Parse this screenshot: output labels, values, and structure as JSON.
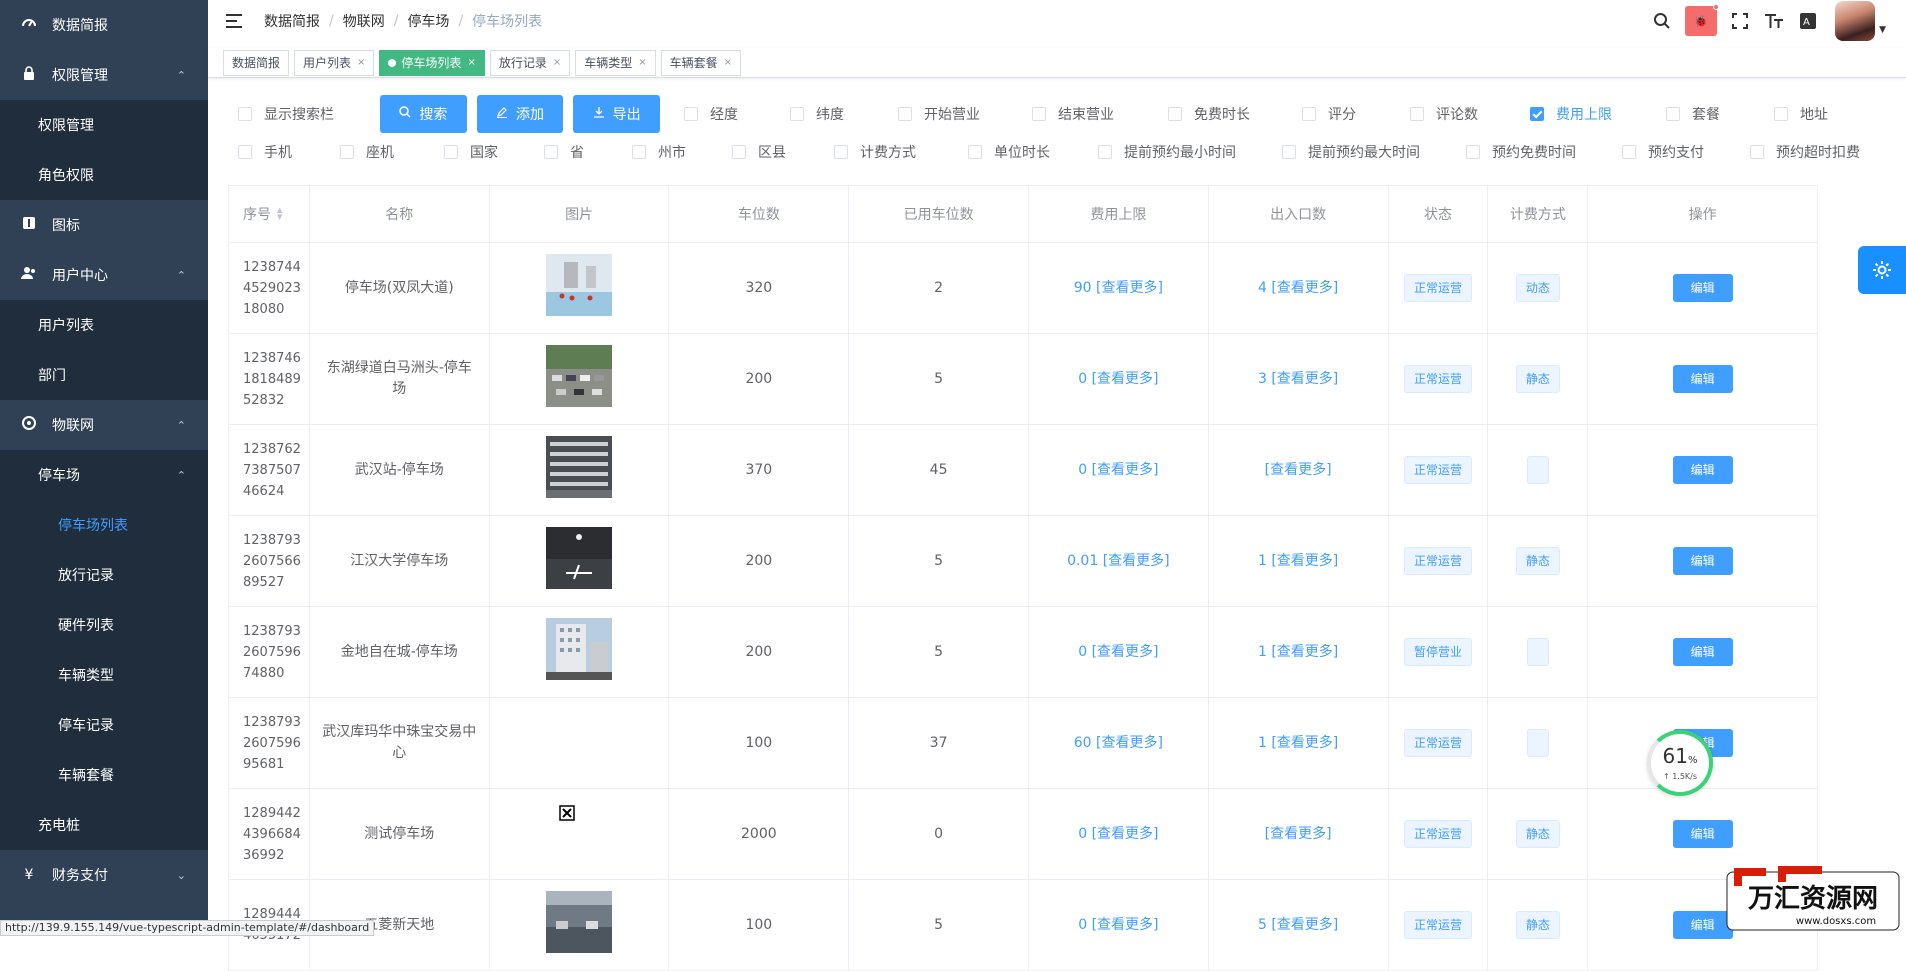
{
  "sidebar": {
    "items": [
      {
        "label": "数据简报",
        "icon": "dashboard-icon",
        "kind": "top"
      },
      {
        "label": "权限管理",
        "icon": "lock-icon",
        "kind": "top",
        "chev": "⌃"
      },
      {
        "label": "权限管理",
        "kind": "sub"
      },
      {
        "label": "角色权限",
        "kind": "sub"
      },
      {
        "label": "图标",
        "icon": "info-icon",
        "kind": "top"
      },
      {
        "label": "用户中心",
        "icon": "users-icon",
        "kind": "top",
        "chev": "⌃"
      },
      {
        "label": "用户列表",
        "kind": "sub"
      },
      {
        "label": "部门",
        "kind": "sub"
      },
      {
        "label": "物联网",
        "icon": "iot-icon",
        "kind": "top",
        "chev": "⌃"
      },
      {
        "label": "停车场",
        "kind": "sub",
        "chev": "⌃"
      },
      {
        "label": "停车场列表",
        "kind": "sub2",
        "active": true
      },
      {
        "label": "放行记录",
        "kind": "sub2"
      },
      {
        "label": "硬件列表",
        "kind": "sub2"
      },
      {
        "label": "车辆类型",
        "kind": "sub2"
      },
      {
        "label": "停车记录",
        "kind": "sub2"
      },
      {
        "label": "车辆套餐",
        "kind": "sub2"
      },
      {
        "label": "充电桩",
        "kind": "sub"
      },
      {
        "label": "财务支付",
        "icon": "yen-icon",
        "kind": "top",
        "chev": "⌄"
      }
    ]
  },
  "breadcrumb": [
    "数据简报",
    "物联网",
    "停车场",
    "停车场列表"
  ],
  "navbar": {
    "bug_label": "🐞"
  },
  "tags": [
    {
      "label": "数据简报",
      "closable": false,
      "active": false
    },
    {
      "label": "用户列表",
      "closable": true,
      "active": false
    },
    {
      "label": "停车场列表",
      "closable": true,
      "active": true
    },
    {
      "label": "放行记录",
      "closable": true,
      "active": false
    },
    {
      "label": "车辆类型",
      "closable": true,
      "active": false
    },
    {
      "label": "车辆套餐",
      "closable": true,
      "active": false
    }
  ],
  "toolbar": {
    "show_search": "显示搜索栏",
    "search_btn": "搜索",
    "add_btn": "添加",
    "export_btn": "导出",
    "row1_checks": [
      {
        "label": "经度",
        "checked": false
      },
      {
        "label": "纬度",
        "checked": false
      },
      {
        "label": "开始营业",
        "checked": false
      },
      {
        "label": "结束营业",
        "checked": false
      },
      {
        "label": "免费时长",
        "checked": false
      },
      {
        "label": "评分",
        "checked": false
      },
      {
        "label": "评论数",
        "checked": false
      },
      {
        "label": "费用上限",
        "checked": true
      },
      {
        "label": "套餐",
        "checked": false
      },
      {
        "label": "地址",
        "checked": false
      }
    ],
    "row2_checks": [
      {
        "label": "手机",
        "checked": false
      },
      {
        "label": "座机",
        "checked": false
      },
      {
        "label": "国家",
        "checked": false
      },
      {
        "label": "省",
        "checked": false
      },
      {
        "label": "州市",
        "checked": false
      },
      {
        "label": "区县",
        "checked": false
      },
      {
        "label": "计费方式",
        "checked": false
      },
      {
        "label": "单位时长",
        "checked": false
      },
      {
        "label": "提前预约最小时间",
        "checked": false
      },
      {
        "label": "提前预约最大时间",
        "checked": false
      },
      {
        "label": "预约免费时间",
        "checked": false
      },
      {
        "label": "预约支付",
        "checked": false
      },
      {
        "label": "预约超时扣费",
        "checked": false
      }
    ]
  },
  "table": {
    "headers": [
      "序号",
      "名称",
      "图片",
      "车位数",
      "已用车位数",
      "费用上限",
      "出入口数",
      "状态",
      "计费方式",
      "操作"
    ],
    "more_text": "[查看更多]",
    "edit_label": "编辑",
    "rows": [
      {
        "id": "123874445290231 8080",
        "id_lines": [
          "1238744",
          "4529023",
          "18080"
        ],
        "name": "停车场(双凤大道)",
        "img": "site",
        "spaces": "320",
        "used": "2",
        "fee": "90",
        "gates": "4",
        "status": "正常运营",
        "billing": "动态"
      },
      {
        "id_lines": [
          "1238746",
          "1818489",
          "52832"
        ],
        "name": "东湖绿道白马洲头-停车场",
        "img": "lot",
        "spaces": "200",
        "used": "5",
        "fee": "0",
        "gates": "3",
        "status": "正常运营",
        "billing": "静态"
      },
      {
        "id_lines": [
          "1238762",
          "7387507",
          "46624"
        ],
        "name": "武汉站-停车场",
        "img": "aerial",
        "spaces": "370",
        "used": "45",
        "fee": "0",
        "gates": "",
        "status": "正常运营",
        "billing": ""
      },
      {
        "id_lines": [
          "1238793",
          "2607566",
          "89527"
        ],
        "name": "江汉大学停车场",
        "img": "garage",
        "spaces": "200",
        "used": "5",
        "fee": "0.01",
        "gates": "1",
        "status": "正常运营",
        "billing": "静态"
      },
      {
        "id_lines": [
          "1238793",
          "2607596",
          "74880"
        ],
        "name": "金地自在城-停车场",
        "img": "building",
        "spaces": "200",
        "used": "5",
        "fee": "0",
        "gates": "1",
        "status": "暂停营业",
        "billing": ""
      },
      {
        "id_lines": [
          "1238793",
          "2607596",
          "95681"
        ],
        "name": "武汉库玛华中珠宝交易中心",
        "img": "none",
        "spaces": "100",
        "used": "37",
        "fee": "60",
        "gates": "1",
        "status": "正常运营",
        "billing": ""
      },
      {
        "id_lines": [
          "1289442",
          "4396684",
          "36992"
        ],
        "name": "测试停车场",
        "img": "broken",
        "spaces": "2000",
        "used": "0",
        "fee": "0",
        "gates": "",
        "status": "正常运营",
        "billing": "静态"
      },
      {
        "id_lines": [
          "1289444",
          "4655172",
          ""
        ],
        "name": "五菱新天地",
        "img": "indoor",
        "spaces": "100",
        "used": "5",
        "fee": "0",
        "gates": "5",
        "status": "正常运营",
        "billing": "静态"
      }
    ]
  },
  "network_widget": {
    "percent": "61",
    "unit": "%",
    "speed": "↑ 1.5K/s"
  },
  "status_url": "http://139.9.155.149/vue-typescript-admin-template/#/dashboard",
  "watermark": {
    "text": "万汇资源网",
    "url": "www.dosxs.com"
  },
  "colors": {
    "primary": "#409eff",
    "sidebar_bg": "#304156",
    "tag_active": "#42b983",
    "danger": "#f56c6c"
  }
}
